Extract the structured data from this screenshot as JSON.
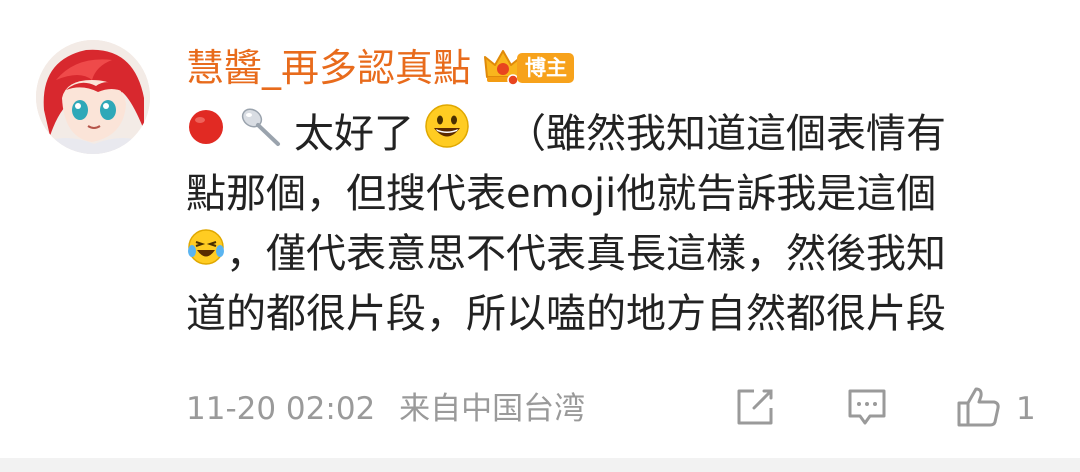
{
  "user": {
    "name": "慧醬_再多認真點",
    "badge_label": "博主",
    "avatar": "anime-girl-red-hair-avatar"
  },
  "comment": {
    "leading_icons": [
      "red-circle-emoji",
      "spoon-emoji"
    ],
    "line1_text": "太好了",
    "line1_emoji": "grinning-face-emoji",
    "line1_after": "（雖然我知道這個表情有",
    "line2": "點那個，但搜代表emoji他就告訴我是這個",
    "line3_emoji": "laughing-crying-emoji",
    "line3_text": "，僅代表意思不代表真長這樣，然後我知",
    "line4": "道的都很片段，所以嗑的地方自然都很片段"
  },
  "footer": {
    "timestamp": "11-20 02:02",
    "location": "来自中国台湾",
    "like_count": "1",
    "icons": [
      "share-icon",
      "reply-comment-icon",
      "thumbs-up-icon"
    ]
  },
  "colors": {
    "username": "#e86b1c",
    "badge": "#f7a21b",
    "text": "#222222",
    "meta": "#9a9a9a"
  }
}
